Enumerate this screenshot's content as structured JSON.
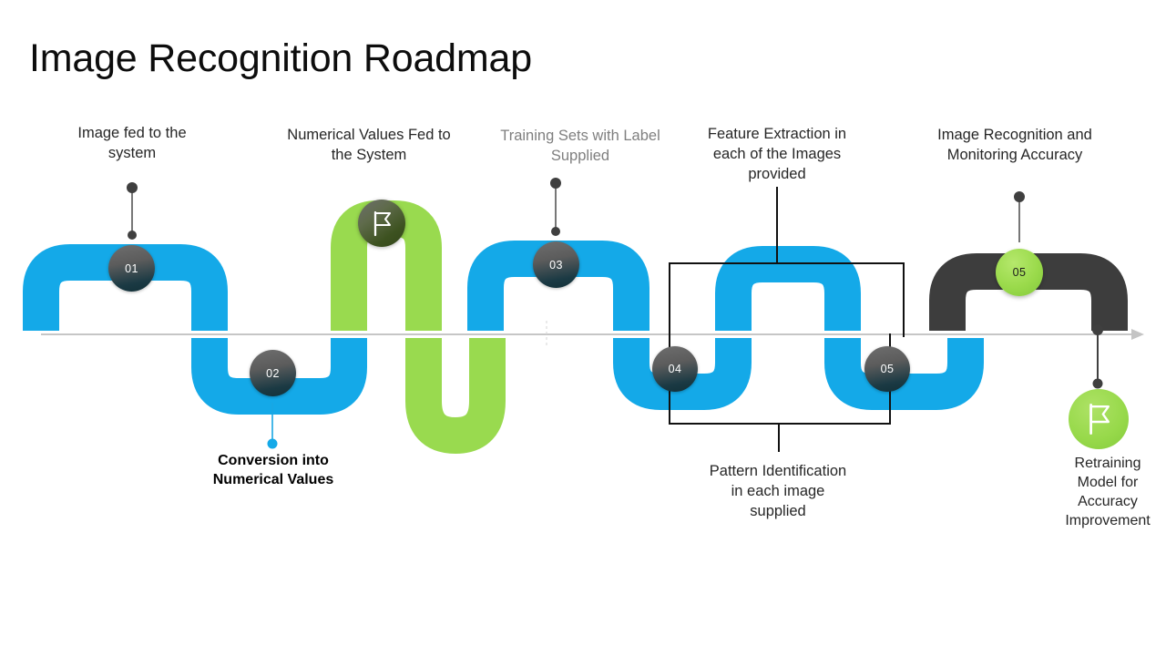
{
  "page": {
    "title": "Image Recognition Roadmap"
  },
  "colors": {
    "blue": "#14a9e8",
    "green": "#99da4f",
    "dark": "#3d3d3d",
    "badge_dark_top": "#6e6e6e",
    "badge_dark_bottom": "#123038",
    "axis_gray": "#b3b3b3",
    "label_gray": "#7f7f7f",
    "text_black": "#262626"
  },
  "axis": {
    "name": "timeline-axis",
    "arrow": "arrow-right"
  },
  "steps": [
    {
      "id": "step-01",
      "number": "01",
      "label": "Image fed to the\nsystem",
      "label_line1": "Image fed to the",
      "label_line2": "system",
      "position": "above",
      "badge_style": "dark",
      "connector_color": "#404040"
    },
    {
      "id": "step-02",
      "number": "02",
      "label": "Conversion into\nNumerical Values",
      "label_line1": "Conversion into",
      "label_line2": "Numerical Values",
      "position": "below",
      "badge_style": "dark",
      "connector_color": "#14a9e8"
    },
    {
      "id": "step-03",
      "number": "03",
      "label": "Training Sets with Label\nSupplied",
      "label_line1": "Training Sets with Label",
      "label_line2": "Supplied",
      "position": "above",
      "badge_style": "dark",
      "connector_color": "#404040"
    },
    {
      "id": "step-04",
      "number": "04",
      "label": "Feature Extraction in\neach of the Images\nprovided",
      "position": "bracket-above",
      "badge_style": "dark"
    },
    {
      "id": "step-05",
      "number": "05",
      "label": "Pattern Identification\nin each image\nsupplied",
      "position": "bracket-below",
      "badge_style": "dark"
    },
    {
      "id": "step-06",
      "number": "05",
      "label": "Image Recognition and\nMonitoring Accuracy",
      "label_line1": "Image Recognition and",
      "label_line2": "Monitoring Accuracy",
      "position": "above",
      "badge_style": "green",
      "connector_color": "#404040"
    }
  ],
  "milestones": [
    {
      "id": "milestone-start-green",
      "icon": "flag-icon",
      "circle_style": "olive",
      "label": ""
    },
    {
      "id": "milestone-retraining",
      "icon": "flag-icon",
      "circle_style": "green",
      "label": "Retraining\nModel for\nAccuracy\nImprovement",
      "label_line1": "Retraining",
      "label_line2": "Model for",
      "label_line3": "Accuracy",
      "label_line4": "Improvement"
    }
  ],
  "brackets": [
    {
      "id": "bracket-top",
      "heading_line1": "Feature Extraction in",
      "heading_line2": "each of the Images",
      "heading_line3": "provided"
    },
    {
      "id": "bracket-bottom",
      "heading_line1": "Pattern Identification",
      "heading_line2": "in each image",
      "heading_line3": "supplied"
    }
  ]
}
